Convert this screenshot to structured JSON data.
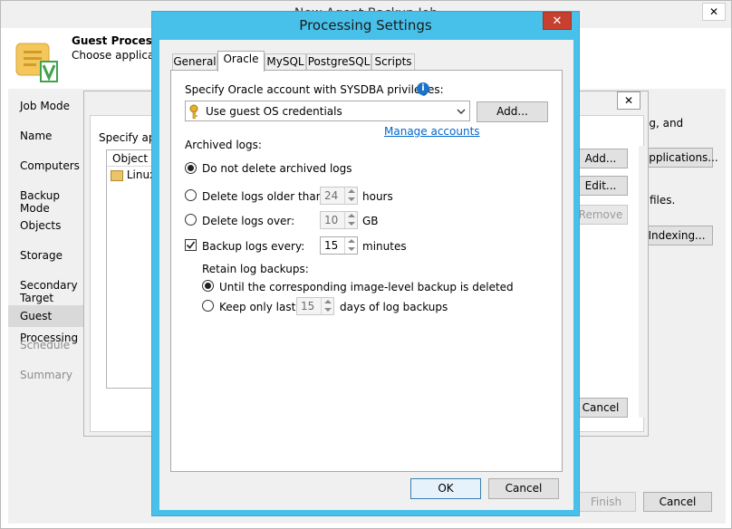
{
  "background_window": {
    "title": "New Agent Backup Job",
    "header_title": "Guest Processing",
    "header_subtitle": "Choose application-aware processing options.",
    "nav_items": [
      {
        "label": "Job Mode",
        "state": "normal"
      },
      {
        "label": "Name",
        "state": "normal"
      },
      {
        "label": "Computers",
        "state": "normal"
      },
      {
        "label": "Backup Mode",
        "state": "normal"
      },
      {
        "label": "Objects",
        "state": "normal"
      },
      {
        "label": "Storage",
        "state": "normal"
      },
      {
        "label": "Secondary Target",
        "state": "normal"
      },
      {
        "label": "Guest Processing",
        "state": "selected"
      },
      {
        "label": "Schedule",
        "state": "disabled"
      },
      {
        "label": "Summary",
        "state": "disabled"
      }
    ],
    "right_text_1": "ag, and",
    "right_text_2": "files.",
    "applications_button": "Applications...",
    "indexing_button": "Indexing...",
    "finish_button": "Finish",
    "cancel_button": "Cancel"
  },
  "middle_dialog": {
    "label": "Specify application-aware processing settings",
    "list_header": "Object",
    "list_row": "Linux",
    "add_button": "Add...",
    "edit_button": "Edit...",
    "remove_button": "Remove",
    "cancel_button": "Cancel"
  },
  "dialog": {
    "title": "Processing Settings",
    "close_glyph": "✕",
    "tabs": [
      {
        "label": "General",
        "active": false
      },
      {
        "label": "Oracle",
        "active": true
      },
      {
        "label": "MySQL",
        "active": false
      },
      {
        "label": "PostgreSQL",
        "active": false
      },
      {
        "label": "Scripts",
        "active": false
      }
    ],
    "account_label": "Specify Oracle account with SYSDBA privileges:",
    "account_value": "Use guest OS credentials",
    "add_button": "Add...",
    "manage_link": "Manage accounts",
    "archived_logs_label": "Archived logs:",
    "opt_do_not_delete": "Do not delete archived logs",
    "opt_delete_older": "Delete logs older than:",
    "older_value": "24",
    "older_unit": "hours",
    "opt_delete_over": "Delete logs over:",
    "over_value": "10",
    "over_unit": "GB",
    "backup_logs_label": "Backup logs every:",
    "backup_logs_checked": true,
    "backup_every_value": "15",
    "backup_every_unit": "minutes",
    "retain_label": "Retain log backups:",
    "retain_opt1": "Until the corresponding image-level backup is deleted",
    "retain_opt2": "Keep only last",
    "retain_days_value": "15",
    "retain_days_unit": "days of log backups",
    "ok_button": "OK",
    "cancel_button": "Cancel"
  }
}
